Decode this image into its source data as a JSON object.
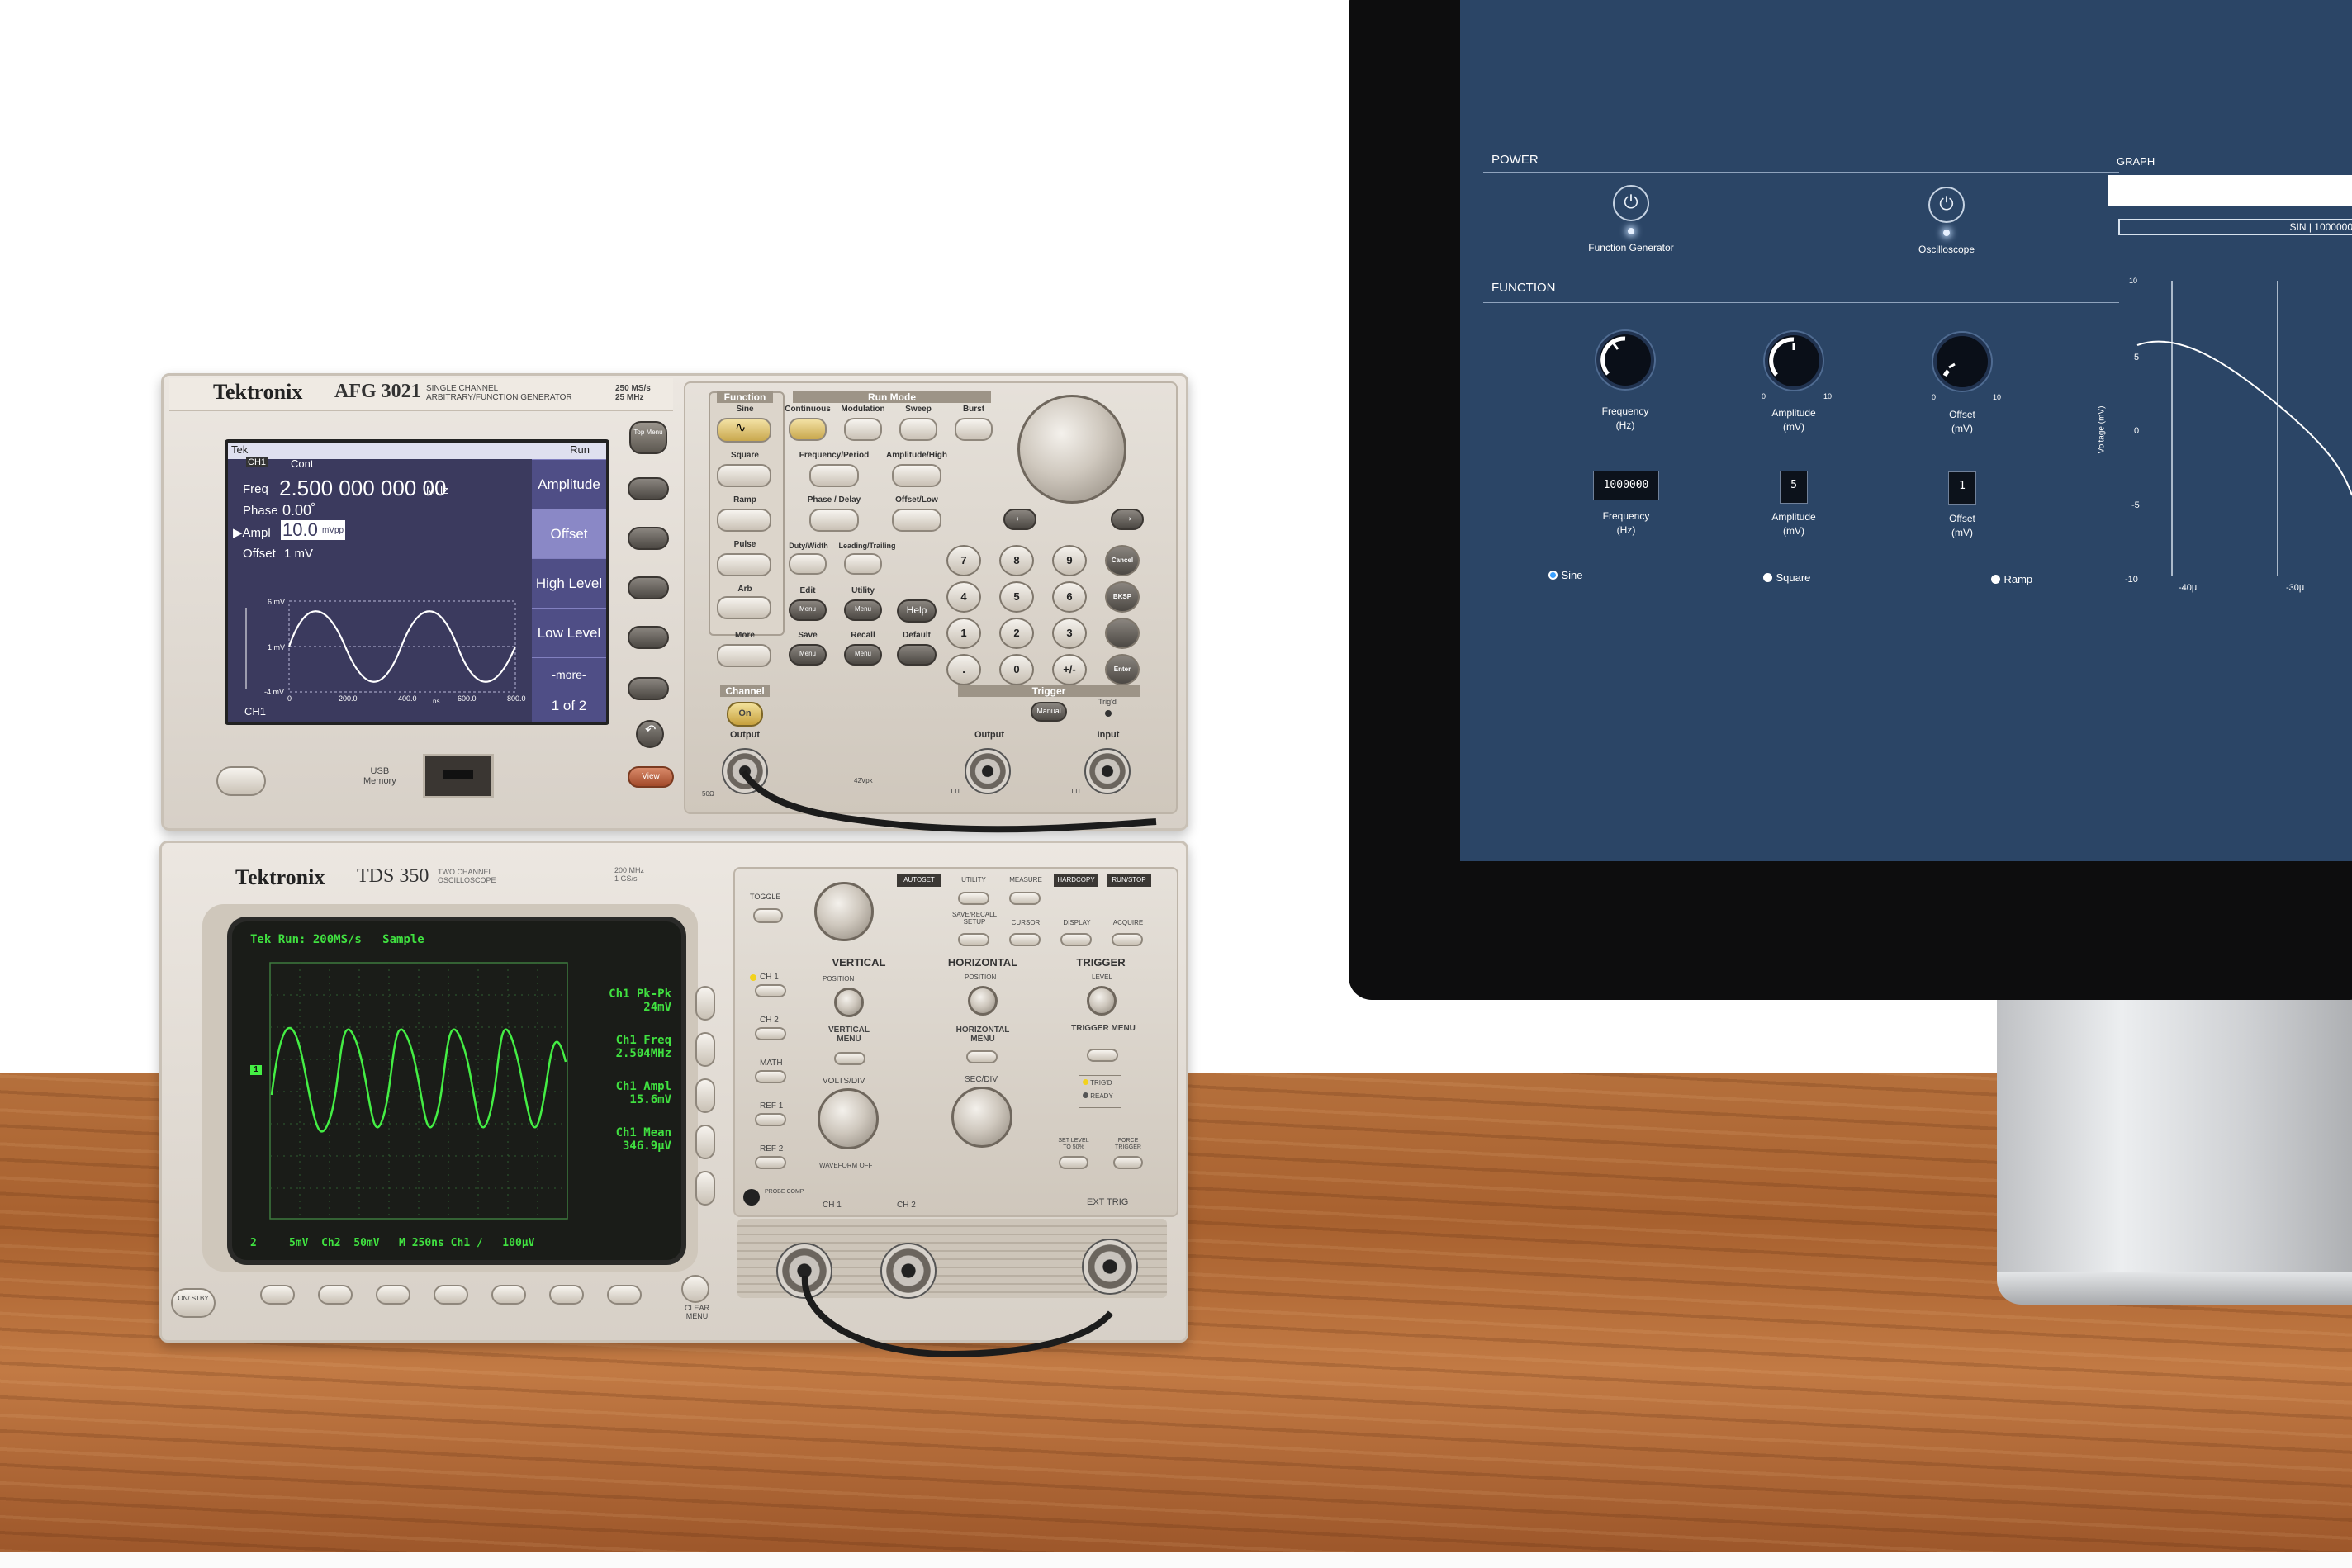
{
  "afg": {
    "brand": "Tektronix",
    "model": "AFG 3021",
    "model_desc_1": "SINGLE CHANNEL",
    "model_desc_2": "ARBITRARY/FUNCTION GENERATOR",
    "spec_1": "250 MS/s",
    "spec_2": "25 MHz",
    "screen": {
      "header_tek": "Tek",
      "header_ch": "CH1",
      "header_mode": "Cont",
      "header_right": "Run",
      "freq_label": "Freq",
      "freq_value": "2.500 000 000 00",
      "freq_unit": "MHz",
      "phase_label": "Phase",
      "phase_value": "0.00",
      "phase_unit": "°",
      "ampl_label": "Ampl",
      "ampl_value": "10.0",
      "ampl_unit": "mVpp",
      "offset_label": "Offset",
      "offset_value": "1 mV",
      "y_labels": [
        "6 mV",
        "1 mV",
        "-4 mV"
      ],
      "x_labels": [
        "0",
        "200.0",
        "400.0",
        "600.0",
        "800.0"
      ],
      "x_unit": "ns",
      "ch_footer": "CH1",
      "softkeys": [
        "Amplitude",
        "Offset",
        "High Level",
        "Low Level",
        "-more-",
        "1 of 2"
      ]
    },
    "top_menu": "Top Menu",
    "usb": "USB",
    "memory": "Memory",
    "view": "View",
    "function_title": "Function",
    "functions": [
      "Sine",
      "Square",
      "Ramp",
      "Pulse",
      "Arb",
      "More"
    ],
    "run_mode_title": "Run Mode",
    "run_modes": [
      "Continuous",
      "Modulation",
      "Sweep",
      "Burst"
    ],
    "param_buttons": [
      "Frequency/Period",
      "Amplitude/High",
      "Phase / Delay",
      "Offset/Low",
      "Duty/Width",
      "Leading/Trailing"
    ],
    "menu_buttons": [
      "Edit",
      "Utility",
      "Save",
      "Recall"
    ],
    "menu_sub": "Menu",
    "help": "Help",
    "default": "Default",
    "keypad": [
      "7",
      "8",
      "9",
      "Cancel",
      "4",
      "5",
      "6",
      "BKSP",
      "1",
      "2",
      "3",
      "",
      ".",
      "0",
      "+/-",
      "Enter"
    ],
    "channel_title": "Channel",
    "on": "On",
    "output": "Output",
    "trigger_title": "Trigger",
    "manual": "Manual",
    "trigd": "Trig'd",
    "trig_output": "Output",
    "trig_input": "Input",
    "ttl_1": "TTL",
    "ttl_2": "TTL",
    "ohm": "50Ω",
    "volt_warning": "42Vpk"
  },
  "tds": {
    "brand": "Tektronix",
    "model": "TDS 350",
    "model_desc_1": "TWO CHANNEL",
    "model_desc_2": "OSCILLOSCOPE",
    "spec_1": "200 MHz",
    "spec_2": "1 GS/s",
    "screen": {
      "top": "Tek Run: 200MS/s",
      "top_mode": "Sample",
      "meas": [
        {
          "label": "Ch1 Pk-Pk",
          "value": "24mV"
        },
        {
          "label": "Ch1 Freq",
          "value": "2.504MHz"
        },
        {
          "label": "Ch1 Ampl",
          "value": "15.6mV"
        },
        {
          "label": "Ch1 Mean",
          "value": "346.9μV"
        }
      ],
      "bottom": [
        "5mV",
        "Ch2",
        "50mV",
        "M 250ns",
        "Ch1",
        "∕",
        "100μV"
      ],
      "ch_marker": "1",
      "ch_marker_bottom": "2"
    },
    "top_buttons": [
      "AUTOSET",
      "UTILITY",
      "MEASURE",
      "HARDCOPY",
      "RUN/STOP"
    ],
    "row2_buttons": [
      "SAVE/RECALL SETUP",
      "CURSOR",
      "DISPLAY",
      "ACQUIRE"
    ],
    "toggle": "TOGGLE",
    "vertical_title": "VERTICAL",
    "horizontal_title": "HORIZONTAL",
    "trigger_title": "TRIGGER",
    "channels": [
      "CH 1",
      "CH 2",
      "MATH",
      "REF 1",
      "REF 2"
    ],
    "position": "POSITION",
    "vertical_menu": "VERTICAL MENU",
    "horizontal_menu": "HORIZONTAL MENU",
    "trigger_menu": "TRIGGER MENU",
    "level": "LEVEL",
    "volts_div": "VOLTS/DIV",
    "sec_div": "SEC/DIV",
    "waveform_off": "WAVEFORM OFF",
    "trigd": "TRIG'D",
    "ready": "READY",
    "set_level": "SET LEVEL TO 50%",
    "force_trigger": "FORCE TRIGGER",
    "probe_comp": "PROBE COMP",
    "in_1": "CH 1",
    "in_2": "CH 2",
    "ext_trig": "EXT TRIG",
    "on_stby": "ON/ STBY",
    "clear_menu": "CLEAR MENU"
  },
  "app": {
    "power_title": "POWER",
    "power_items": [
      "Function Generator",
      "Oscilloscope"
    ],
    "function_title": "FUNCTION",
    "dials": [
      {
        "label": "Frequency",
        "unit": "(Hz)",
        "min": "",
        "max": "",
        "level": 0.35
      },
      {
        "label": "Amplitude",
        "unit": "(mV)",
        "min": "0",
        "max": "10",
        "level": 0.5
      },
      {
        "label": "Offset",
        "unit": "(mV)",
        "min": "0",
        "max": "10",
        "level": 0.1
      }
    ],
    "fields": [
      {
        "value": "1000000",
        "label": "Frequency",
        "unit": "(Hz)"
      },
      {
        "value": "5",
        "label": "Amplitude",
        "unit": "(mV)"
      },
      {
        "value": "1",
        "label": "Offset",
        "unit": "(mV)"
      }
    ],
    "waveforms": [
      {
        "label": "Sine",
        "selected": true
      },
      {
        "label": "Square",
        "selected": false
      },
      {
        "label": "Ramp",
        "selected": false
      }
    ],
    "graph_title": "GRAPH",
    "graph_caption": "SIN | 1000000",
    "y_ticks": [
      "10",
      "5",
      "0",
      "-5",
      "-10"
    ],
    "x_ticks": [
      "-40μ",
      "-30μ"
    ],
    "y_label": "Voltage (mV)"
  },
  "colors": {
    "app_bg": "#2b4566",
    "accent": "#3aa0ff",
    "scope_trace": "#40e040",
    "afg_screen": "#3b3a5e"
  }
}
